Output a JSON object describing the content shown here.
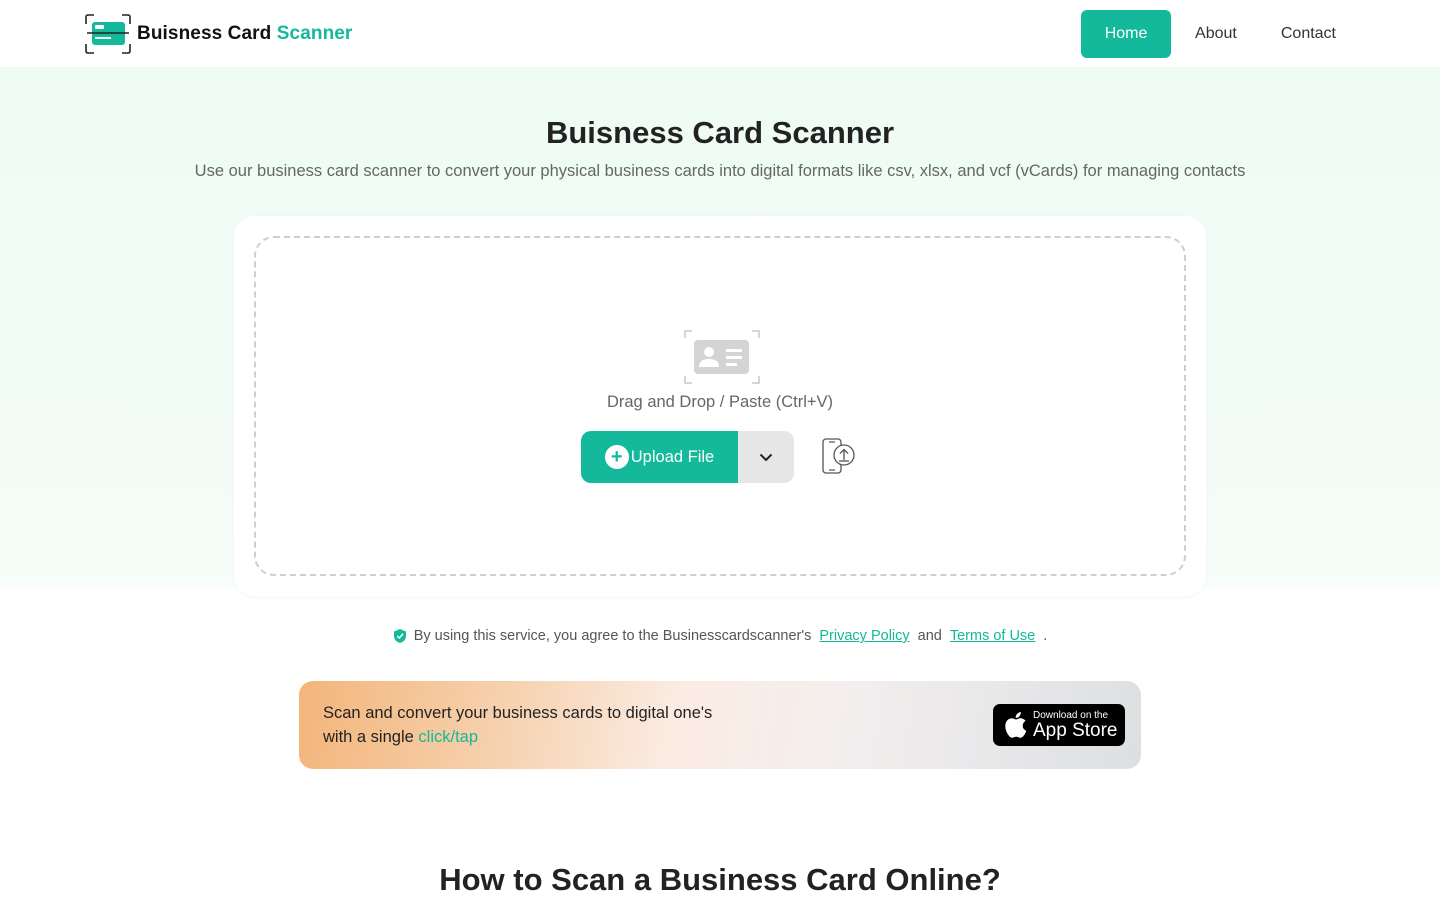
{
  "header": {
    "logo_text_main": "Buisness Card",
    "logo_text_accent": "Scanner",
    "nav": {
      "home": "Home",
      "about": "About",
      "contact": "Contact"
    }
  },
  "hero": {
    "title": "Buisness Card Scanner",
    "subtitle": "Use our business card scanner to convert your physical business cards into digital formats like csv, xlsx, and vcf (vCards) for managing contacts"
  },
  "upload": {
    "drop_text": "Drag and Drop / Paste (Ctrl+V)",
    "upload_label": "Upload File"
  },
  "agreement": {
    "prefix": "By using this service, you agree to the Businesscardscanner's",
    "privacy": "Privacy Policy",
    "and": "and",
    "terms": "Terms of Use",
    "period": "."
  },
  "promo": {
    "text": "Scan and convert your business cards to digital one's with a single",
    "accent": "click/tap",
    "appstore_small": "Download on the",
    "appstore_big": "App Store"
  },
  "howto_title": "How to Scan a Business Card Online?",
  "colors": {
    "accent": "#13b99a",
    "hero_bg": "#eefcf4"
  }
}
